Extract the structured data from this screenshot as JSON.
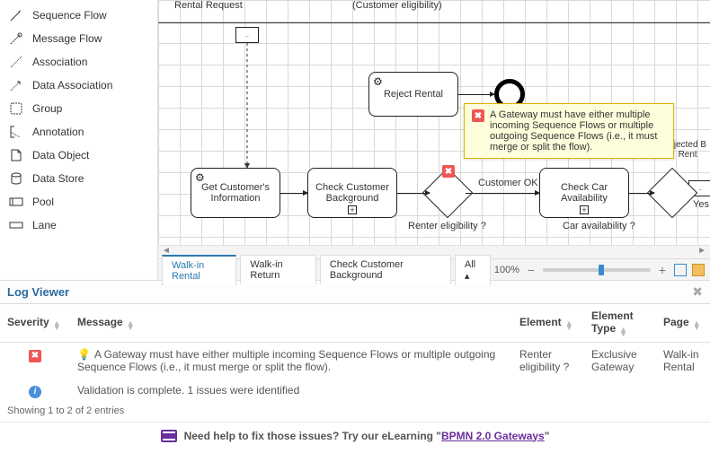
{
  "palette": {
    "items": [
      {
        "label": "Sequence Flow",
        "icon": "seq-flow"
      },
      {
        "label": "Message Flow",
        "icon": "msg-flow"
      },
      {
        "label": "Association",
        "icon": "assoc"
      },
      {
        "label": "Data Association",
        "icon": "data-assoc"
      },
      {
        "label": "Group",
        "icon": "group"
      },
      {
        "label": "Annotation",
        "icon": "annotation"
      },
      {
        "label": "Data Object",
        "icon": "data-object"
      },
      {
        "label": "Data Store",
        "icon": "data-store"
      },
      {
        "label": "Pool",
        "icon": "pool"
      },
      {
        "label": "Lane",
        "icon": "lane"
      }
    ]
  },
  "diagram": {
    "header_label": "Rental Request",
    "header_note": "(Customer eligibility)",
    "tasks": {
      "get_info": "Get Customer's Information",
      "check_bg": "Check Customer Background",
      "reject": "Reject Rental",
      "check_car": "Check Car Availability"
    },
    "gateway_labels": {
      "renter": "Renter eligibility ?",
      "customer_ok": "Customer OK",
      "car_avail": "Car   availability ?",
      "yes": "Yes"
    },
    "rejected_flow": "ejected B\nRent"
  },
  "tooltip": {
    "message": "A Gateway must have either multiple incoming Sequence Flows or multiple outgoing Sequence Flows (i.e., it must merge or split the flow)."
  },
  "tabs": {
    "items": [
      "Walk-in Rental",
      "Walk-in Return",
      "Check Customer Background"
    ],
    "active_index": 0,
    "all_label": "All"
  },
  "zoom": {
    "percent": "100%"
  },
  "log": {
    "title": "Log Viewer",
    "columns": {
      "severity": "Severity",
      "message": "Message",
      "element": "Element",
      "type": "Element Type",
      "page": "Page"
    },
    "rows": [
      {
        "severity": "error",
        "message": "A Gateway must have either multiple incoming Sequence Flows or multiple outgoing Sequence Flows (i.e., it must merge or split the flow).",
        "element": "Renter eligibility ?",
        "type": "Exclusive Gateway",
        "page": "Walk-in Rental"
      },
      {
        "severity": "info",
        "message": "Validation is complete. 1 issues were identified",
        "element": "",
        "type": "",
        "page": ""
      }
    ],
    "footer": "Showing 1 to 2 of 2 entries"
  },
  "elearn": {
    "prefix": "Need help to fix those issues? Try our eLearning \"",
    "link": "BPMN 2.0 Gateways",
    "suffix": "\""
  }
}
